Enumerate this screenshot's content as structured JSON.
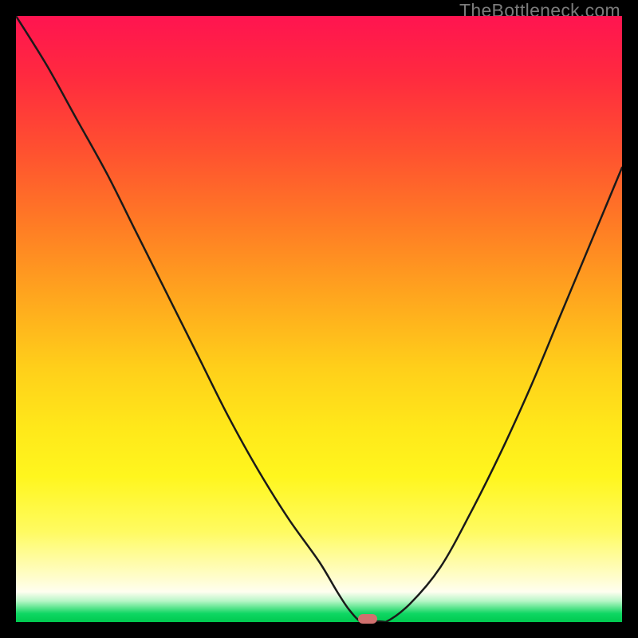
{
  "watermark": "TheBottleneck.com",
  "colors": {
    "frame": "#000000",
    "watermark": "#7b7b7b",
    "curve": "#1a1a1a",
    "marker": "#d1716f"
  },
  "chart_data": {
    "type": "line",
    "title": "",
    "xlabel": "",
    "ylabel": "",
    "xlim": [
      0,
      100
    ],
    "ylim": [
      0,
      100
    ],
    "grid": false,
    "legend": false,
    "series": [
      {
        "name": "bottleneck-curve",
        "x": [
          0,
          5,
          10,
          15,
          20,
          25,
          30,
          35,
          40,
          45,
          50,
          53,
          55,
          57,
          59,
          61,
          65,
          70,
          75,
          80,
          85,
          90,
          95,
          100
        ],
        "y": [
          100,
          92,
          83,
          74,
          64,
          54,
          44,
          34,
          25,
          17,
          10,
          5,
          2,
          0,
          0,
          0,
          3,
          9,
          18,
          28,
          39,
          51,
          63,
          75
        ]
      }
    ],
    "marker": {
      "x": 58,
      "y": 0,
      "shape": "pill"
    },
    "background_gradient": {
      "direction": "top-to-bottom",
      "stops": [
        {
          "pos": 0.0,
          "color": "#ff1450"
        },
        {
          "pos": 0.22,
          "color": "#ff5030"
        },
        {
          "pos": 0.46,
          "color": "#ffa51e"
        },
        {
          "pos": 0.68,
          "color": "#ffe81a"
        },
        {
          "pos": 0.93,
          "color": "#fffdca"
        },
        {
          "pos": 0.97,
          "color": "#4fe287"
        },
        {
          "pos": 1.0,
          "color": "#00c94f"
        }
      ]
    }
  }
}
